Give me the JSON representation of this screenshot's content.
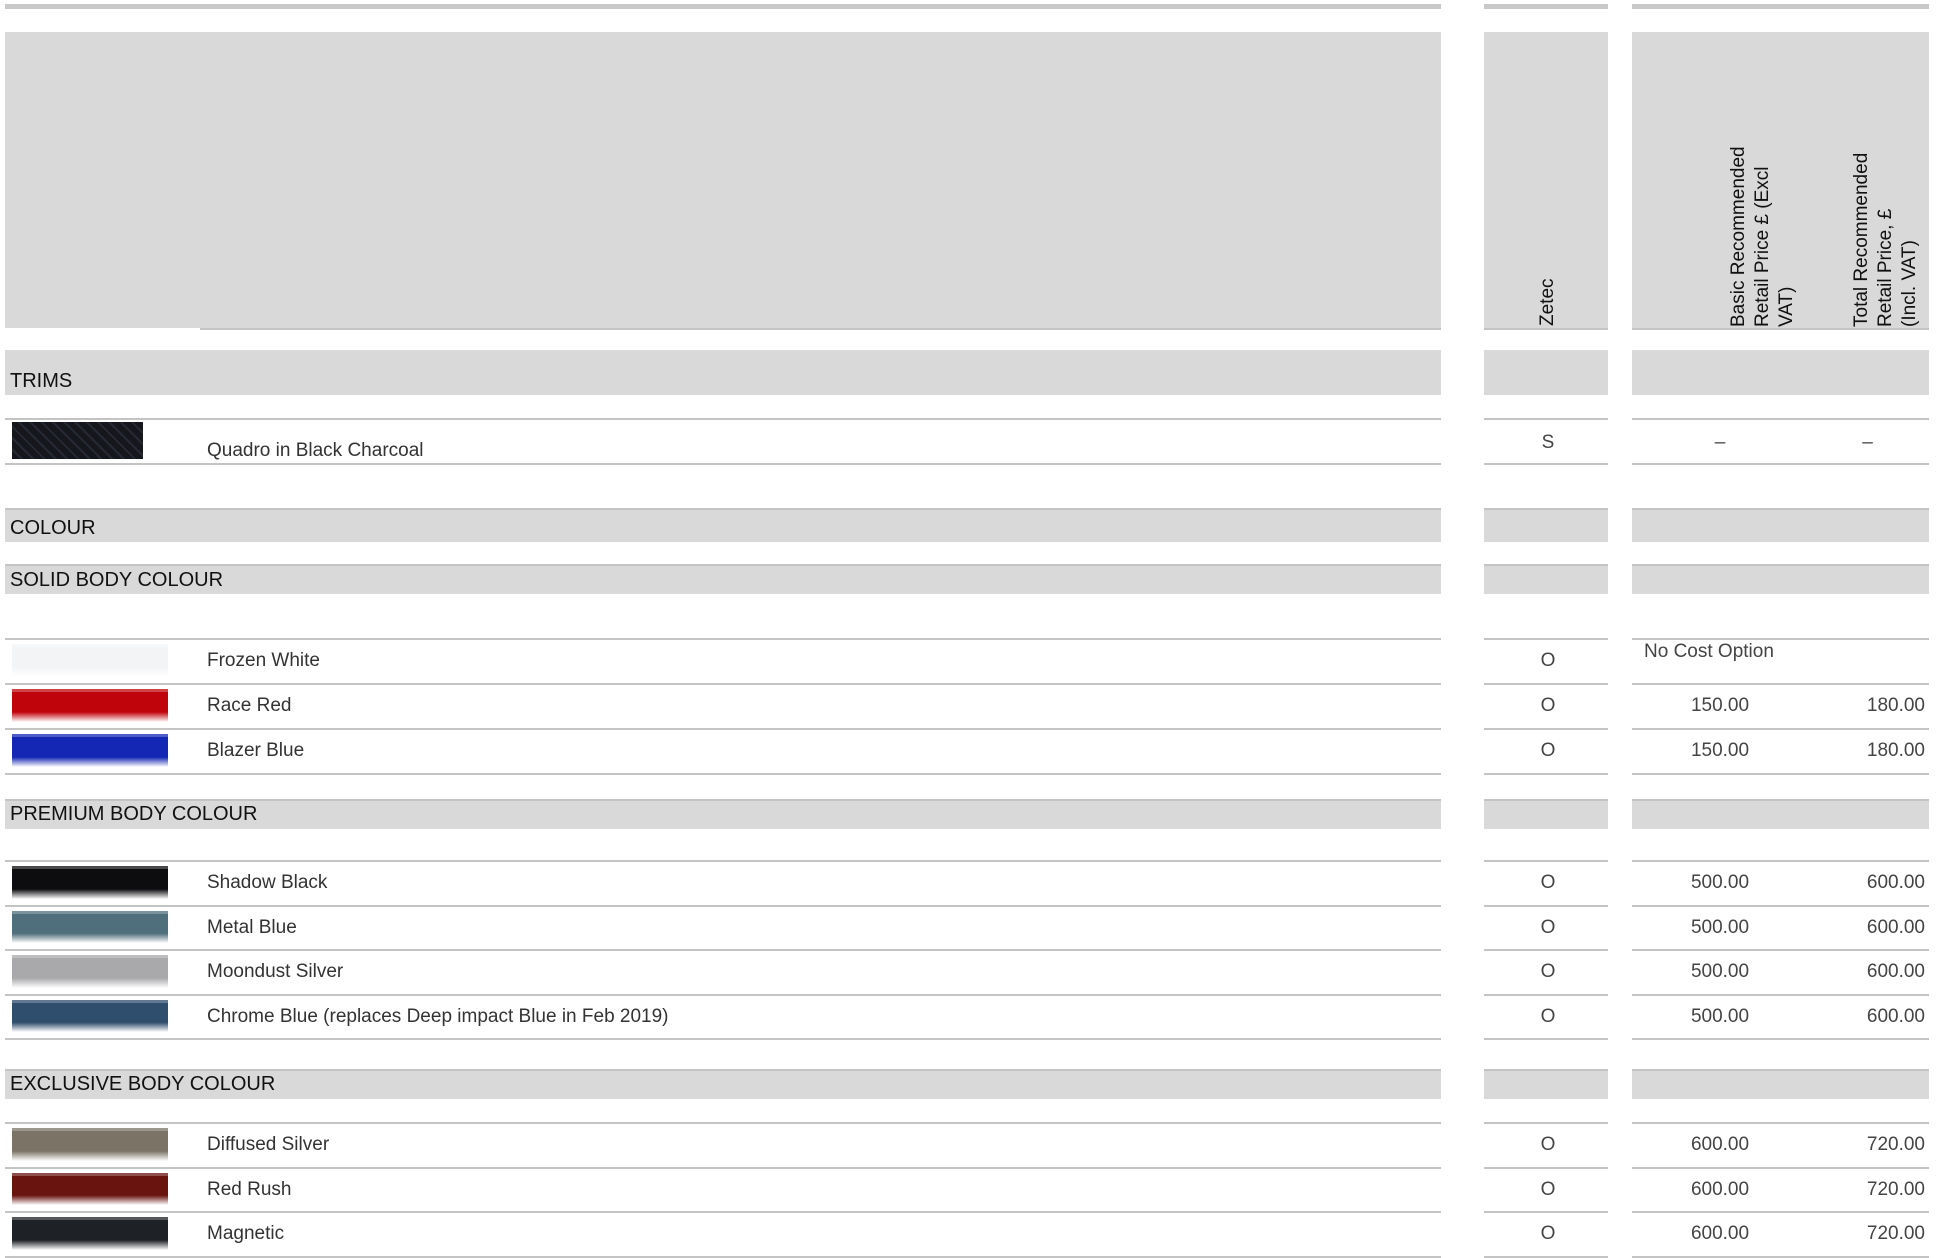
{
  "headers": {
    "zetec": "Zetec",
    "basic_lines": [
      "Basic Recommended",
      "Retail Price £ (Excl",
      "VAT)"
    ],
    "total_lines": [
      "Total Recommended",
      "Retail Price, £",
      "(Incl. VAT)"
    ]
  },
  "sections": {
    "trims": "TRIMS",
    "colour": "COLOUR",
    "solid": "SOLID BODY COLOUR",
    "premium": "PREMIUM BODY COLOUR",
    "exclusive": "EXCLUSIVE BODY COLOUR"
  },
  "trims": [
    {
      "label": "Quadro in Black Charcoal",
      "zetec": "S",
      "basic": "–",
      "total": "–",
      "swatch_color": "#1b1d24"
    }
  ],
  "solid": [
    {
      "label": "Frozen White",
      "zetec": "O",
      "note": "No Cost Option",
      "swatch_color": "#f3f4f6"
    },
    {
      "label": "Race Red",
      "zetec": "O",
      "basic": "150.00",
      "total": "180.00",
      "swatch_color": "#c0040c"
    },
    {
      "label": "Blazer Blue",
      "zetec": "O",
      "basic": "150.00",
      "total": "180.00",
      "swatch_color": "#1327b4"
    }
  ],
  "premium": [
    {
      "label": "Shadow Black",
      "zetec": "O",
      "basic": "500.00",
      "total": "600.00",
      "swatch_color": "#0d0d0f"
    },
    {
      "label": "Metal Blue",
      "zetec": "O",
      "basic": "500.00",
      "total": "600.00",
      "swatch_color": "#4f6f7c"
    },
    {
      "label": "Moondust Silver",
      "zetec": "O",
      "basic": "500.00",
      "total": "600.00",
      "swatch_color": "#a9a9ab"
    },
    {
      "label": "Chrome Blue (replaces Deep impact Blue in Feb 2019)",
      "zetec": "O",
      "basic": "500.00",
      "total": "600.00",
      "swatch_color": "#2f4d6c"
    }
  ],
  "exclusive": [
    {
      "label": "Diffused Silver",
      "zetec": "O",
      "basic": "600.00",
      "total": "720.00",
      "swatch_color": "#7b7466"
    },
    {
      "label": "Red Rush",
      "zetec": "O",
      "basic": "600.00",
      "total": "720.00",
      "swatch_color": "#6a1410"
    },
    {
      "label": "Magnetic",
      "zetec": "O",
      "basic": "600.00",
      "total": "720.00",
      "swatch_color": "#1e2126"
    }
  ]
}
